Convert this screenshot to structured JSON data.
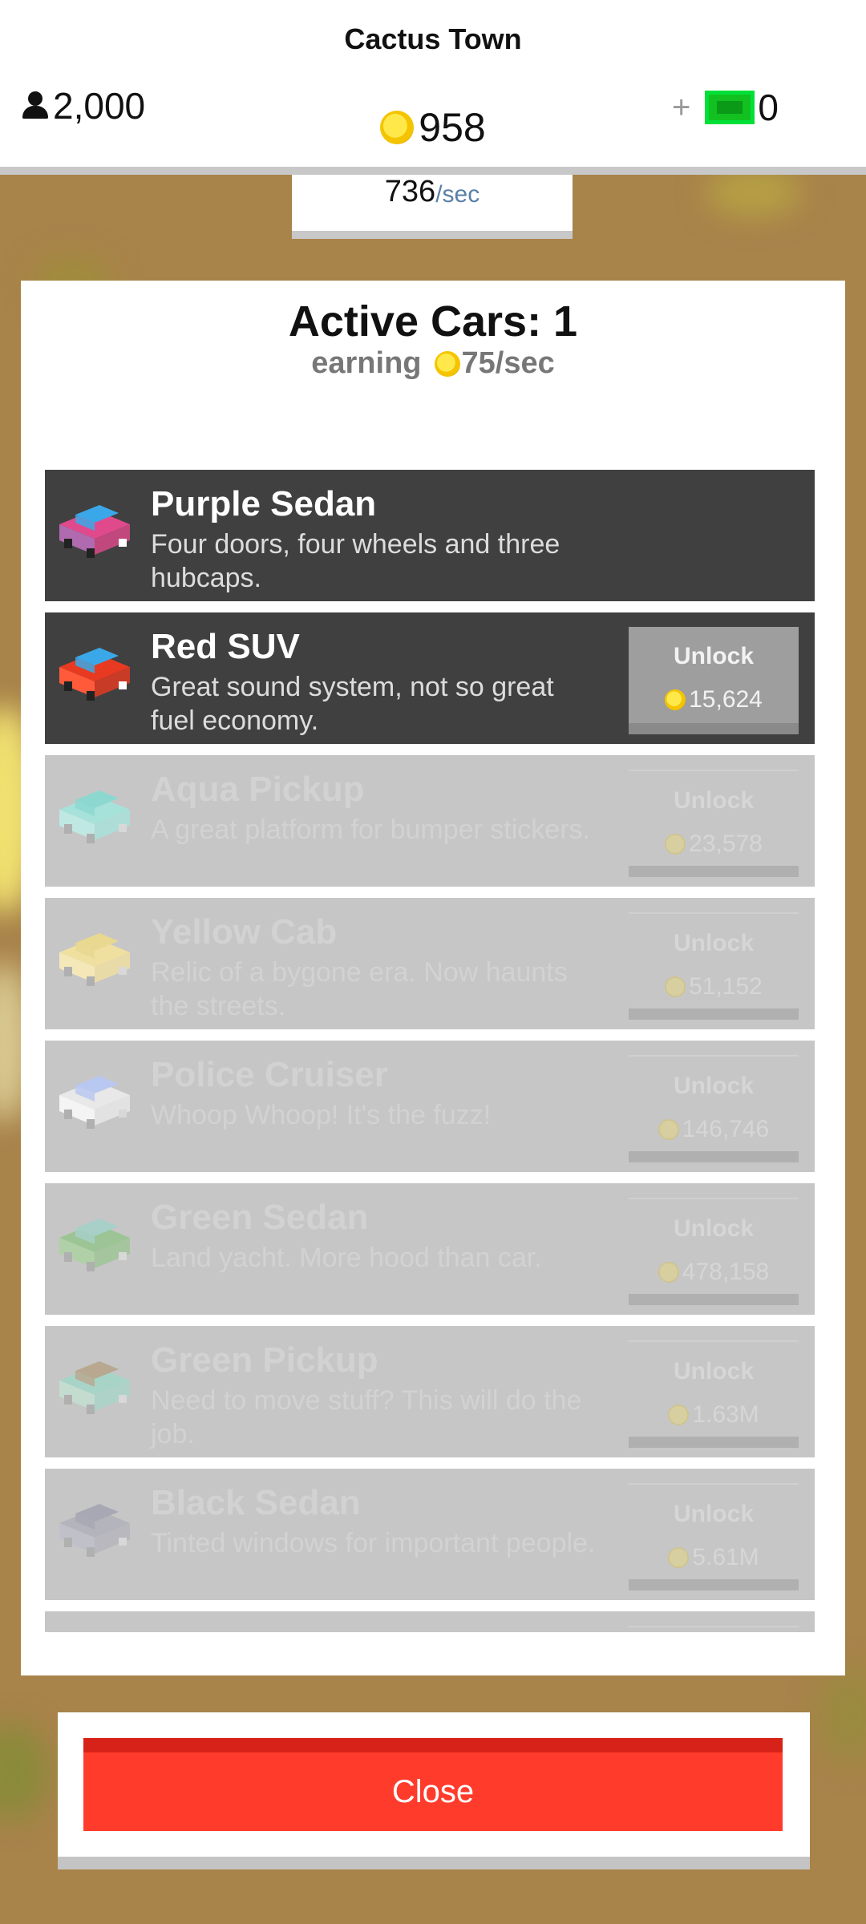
{
  "hud": {
    "town_name": "Cactus Town",
    "population": "2,000",
    "coins": "958",
    "cash_prefix": "+",
    "cash": "0",
    "rate_value": "736",
    "rate_suffix": "/sec"
  },
  "panel": {
    "title": "Active Cars: 1",
    "earning_label": "earning",
    "earning_rate": "75/sec"
  },
  "cars": [
    {
      "name": "Purple Sedan",
      "desc": "Four doors, four wheels and three hubcaps.",
      "locked": false,
      "owned": true,
      "icon": "purple-sedan-icon",
      "colors": [
        "#3aa8e8",
        "#e04a8c",
        "#b06ab0"
      ]
    },
    {
      "name": "Red SUV",
      "desc": "Great sound system, not so great fuel economy.",
      "locked": false,
      "owned": false,
      "unlock_label": "Unlock",
      "price": "15,624",
      "icon": "red-suv-icon",
      "colors": [
        "#3aa8e8",
        "#e83a20",
        "#ff5a3a"
      ]
    },
    {
      "name": "Aqua Pickup",
      "desc": "A great platform for bumper stickers.",
      "locked": true,
      "unlock_label": "Unlock",
      "price": "23,578",
      "icon": "aqua-pickup-icon",
      "colors": [
        "#8cd8d0",
        "#a6e2da",
        "#bfe8e2"
      ]
    },
    {
      "name": "Yellow Cab",
      "desc": "Relic of a bygone era. Now haunts the streets.",
      "locked": true,
      "unlock_label": "Unlock",
      "price": "51,152",
      "icon": "yellow-cab-icon",
      "colors": [
        "#e8d890",
        "#f0e0a0",
        "#f4e8b8"
      ]
    },
    {
      "name": "Police Cruiser",
      "desc": "Whoop Whoop! It's the fuzz!",
      "locked": true,
      "unlock_label": "Unlock",
      "price": "146,746",
      "icon": "police-cruiser-icon",
      "colors": [
        "#b8c8f0",
        "#e8e8e8",
        "#f4f4f4"
      ]
    },
    {
      "name": "Green Sedan",
      "desc": "Land yacht. More hood than car.",
      "locked": true,
      "unlock_label": "Unlock",
      "price": "478,158",
      "icon": "green-sedan-icon",
      "colors": [
        "#a8d0c8",
        "#9cc494",
        "#b0d0a8"
      ]
    },
    {
      "name": "Green Pickup",
      "desc": "Need to move stuff? This will do the job.",
      "locked": true,
      "unlock_label": "Unlock",
      "price": "1.63M",
      "icon": "green-pickup-icon",
      "colors": [
        "#b8a890",
        "#a8d4c8",
        "#c4dcd0"
      ]
    },
    {
      "name": "Black Sedan",
      "desc": "Tinted windows for important people.",
      "locked": true,
      "unlock_label": "Unlock",
      "price": "5.61M",
      "icon": "black-sedan-icon",
      "colors": [
        "#a8a8b4",
        "#b4b4bc",
        "#c0c0c8"
      ]
    },
    {
      "name": "",
      "desc": "",
      "locked": true,
      "unlock_label": "",
      "price": "",
      "icon": "car-icon",
      "colors": [
        "#c0c0c0",
        "#c8c8c8",
        "#d0d0d0"
      ]
    }
  ],
  "footer": {
    "close_label": "Close"
  }
}
